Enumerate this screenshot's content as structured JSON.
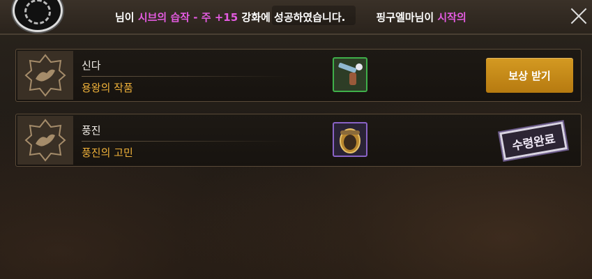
{
  "header": {
    "ticker": {
      "msg1_prefix": "님이 ",
      "msg1_highlight": "시브의 습작 - 주 +15",
      "msg1_suffix": " 강화에 성공하였습니다.",
      "msg2_prefix": "핑구엘마님이 ",
      "msg2_highlight": "시작의"
    },
    "close_icon": "close-icon"
  },
  "rewards": [
    {
      "icon": "shield-bird-emblem-icon",
      "name": "신다",
      "sub": "용왕의 작품",
      "item_icon": "pistol-item-icon",
      "item_rarity_color": "#3fb04a",
      "status": "claimable",
      "button_label": "보상 받기"
    },
    {
      "icon": "shield-bird-emblem-icon",
      "name": "풍진",
      "sub": "풍진의 고민",
      "item_icon": "egg-item-icon",
      "item_rarity_color": "#8a63c6",
      "status": "claimed",
      "stamp_label": "수령완료"
    }
  ],
  "colors": {
    "highlight": "#e35be0",
    "subtitle": "#f0b23a",
    "button": "#c88a18"
  }
}
